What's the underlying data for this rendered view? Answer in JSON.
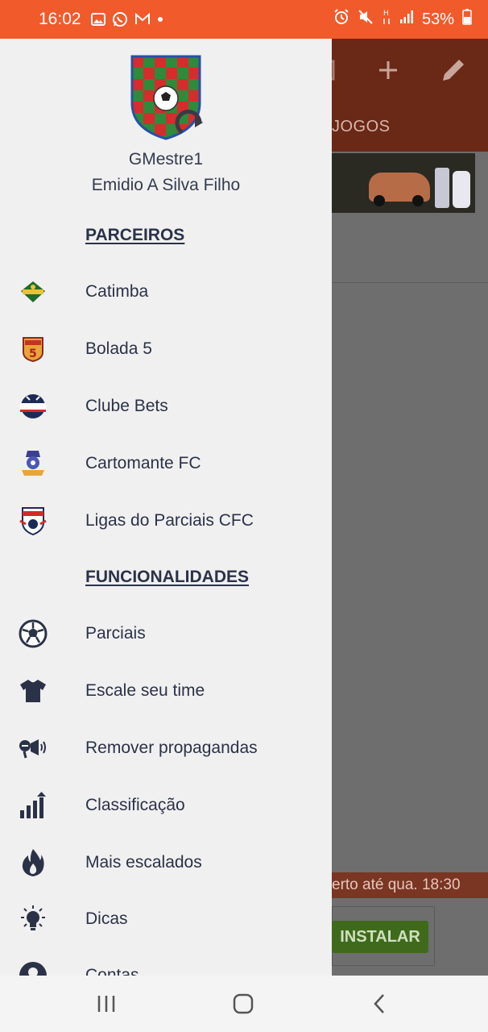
{
  "status_bar": {
    "time": "16:02",
    "battery_percent": "53%",
    "left_icons": [
      "gallery-icon",
      "whatsapp-icon",
      "gmail-icon",
      "dot-icon"
    ],
    "right_icons": [
      "alarm-icon",
      "mute-icon",
      "network-h-icon",
      "signal-icon",
      "battery-icon"
    ]
  },
  "background_app": {
    "tab_label": "JOGOS",
    "ad_text": "erto  até qua. 18:30",
    "install_label": "INSTALAR",
    "toolbar_icons": [
      "calendar-icon",
      "plus-icon",
      "pencil-icon"
    ]
  },
  "drawer": {
    "user_handle": "GMestre1",
    "user_name": "Emidio A Silva Filho",
    "sections": {
      "partners_title": "PARCEIROS",
      "features_title": "FUNCIONALIDADES"
    },
    "partners": [
      {
        "label": "Catimba",
        "icon": "catimba-logo-icon"
      },
      {
        "label": "Bolada 5",
        "icon": "bolada5-logo-icon"
      },
      {
        "label": "Clube Bets",
        "icon": "clube-bets-logo-icon"
      },
      {
        "label": "Cartomante FC",
        "icon": "cartomante-logo-icon"
      },
      {
        "label": "Ligas do Parciais CFC",
        "icon": "parciais-cfc-logo-icon"
      }
    ],
    "features": [
      {
        "label": "Parciais",
        "icon": "soccer-ball-icon"
      },
      {
        "label": "Escale seu time",
        "icon": "jersey-icon"
      },
      {
        "label": "Remover propagandas",
        "icon": "megaphone-icon"
      },
      {
        "label": "Classificação",
        "icon": "bar-chart-icon"
      },
      {
        "label": "Mais escalados",
        "icon": "fire-icon"
      },
      {
        "label": "Dicas",
        "icon": "lightbulb-icon"
      },
      {
        "label": "Contas",
        "icon": "account-icon"
      }
    ]
  },
  "colors": {
    "status_bar": "#f15a2b",
    "drawer_bg": "#f0f0f0",
    "text": "#2b3248",
    "scrim": "#6e6e6e"
  }
}
